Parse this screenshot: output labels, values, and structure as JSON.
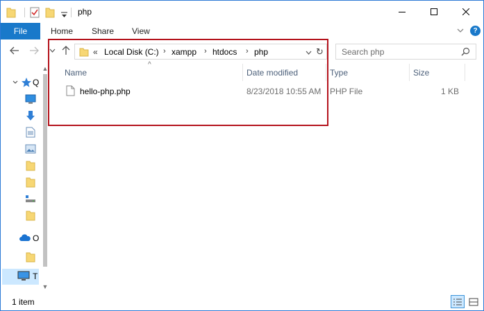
{
  "window": {
    "title": "php",
    "accent": "#1979ca",
    "highlight_color": "#b4121b"
  },
  "ribbon": {
    "file": "File",
    "home": "Home",
    "share": "Share",
    "view": "View",
    "help": "?"
  },
  "address": {
    "overflow": "«",
    "crumbs": [
      "Local Disk (C:)",
      "xampp",
      "htdocs",
      "php"
    ],
    "separator": "›",
    "refresh": "↻"
  },
  "search": {
    "placeholder": "Search php"
  },
  "navpane": {
    "quick_access_letter": "Q",
    "onedrive_letter": "O",
    "thispc_letter": "T"
  },
  "columns": {
    "name": "Name",
    "date_modified": "Date modified",
    "type": "Type",
    "size": "Size",
    "sort_arrow": "^"
  },
  "files": [
    {
      "name": "hello-php.php",
      "date_modified": "8/23/2018 10:55 AM",
      "type": "PHP File",
      "size": "1 KB"
    }
  ],
  "status": {
    "item_count": "1 item"
  }
}
